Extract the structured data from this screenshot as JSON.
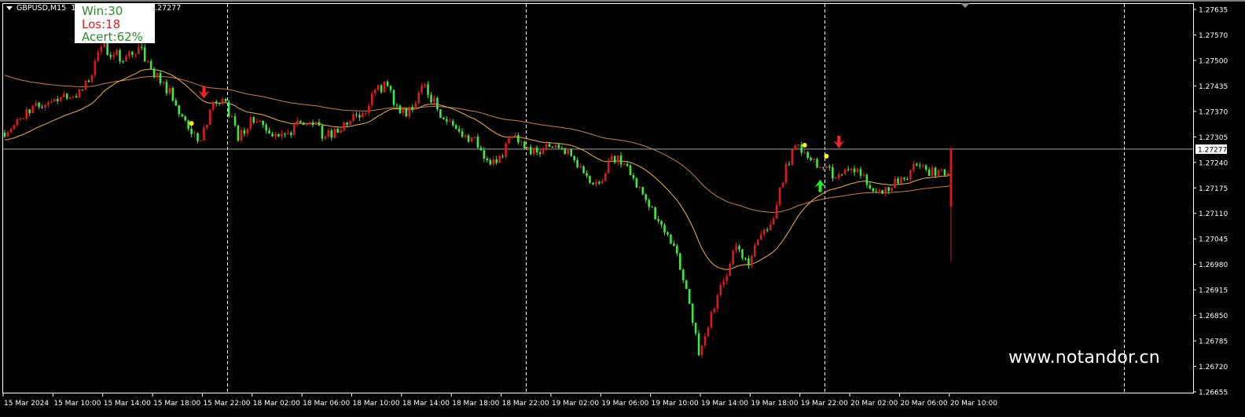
{
  "header": {
    "symbol_timeframe": "GBPUSD,M15",
    "ohlc_visible_head": "1.",
    "ohlc_visible_tail": ".27277"
  },
  "stats_box": {
    "win": "Win:30",
    "los": "Los:18",
    "acert": "Acert:62%"
  },
  "watermark": "www.notandor.cn",
  "colors": {
    "background": "#000000",
    "bull_candle": "#e01818",
    "bear_candle": "#3ee83e",
    "fast_ma": "#f0b050",
    "slow_ma": "#c8804a",
    "grid_separator": "#ffffff",
    "bid_line": "#a0a0a0",
    "signal_dot": "#ffff00",
    "buy_arrow": "#22ee22",
    "sell_arrow": "#ff2020"
  },
  "chart_data": {
    "type": "candlestick",
    "symbol": "GBPUSD",
    "timeframe": "M15",
    "current_price": "1.27277",
    "ylim": [
      1.26655,
      1.27635
    ],
    "y_ticks": [
      "1.27635",
      "1.27570",
      "1.27500",
      "1.27435",
      "1.27370",
      "1.27305",
      "1.27240",
      "1.27175",
      "1.27110",
      "1.27045",
      "1.26980",
      "1.26915",
      "1.26850",
      "1.26785",
      "1.26720",
      "1.26655"
    ],
    "x_ticks": [
      "15 Mar 2024",
      "15 Mar 10:00",
      "15 Mar 14:00",
      "15 Mar 18:00",
      "15 Mar 22:00",
      "18 Mar 02:00",
      "18 Mar 06:00",
      "18 Mar 10:00",
      "18 Mar 14:00",
      "18 Mar 18:00",
      "18 Mar 22:00",
      "19 Mar 02:00",
      "19 Mar 06:00",
      "19 Mar 10:00",
      "19 Mar 14:00",
      "19 Mar 18:00",
      "19 Mar 22:00",
      "20 Mar 02:00",
      "20 Mar 06:00",
      "20 Mar 10:00"
    ],
    "day_separators": [
      "18 Mar 00:00",
      "19 Mar 00:00",
      "20 Mar 00:00",
      "21 Mar 00:00"
    ],
    "hourly_close": [
      [
        "15 Mar 06:00",
        1.27339
      ],
      [
        "15 Mar 07:00",
        1.27379
      ],
      [
        "15 Mar 08:00",
        1.27385
      ],
      [
        "15 Mar 09:00",
        1.27399
      ],
      [
        "15 Mar 10:00",
        1.27419
      ],
      [
        "15 Mar 11:00",
        1.27409
      ],
      [
        "15 Mar 12:00",
        1.27449
      ],
      [
        "15 Mar 13:00",
        1.27539
      ],
      [
        "15 Mar 14:00",
        1.27519
      ],
      [
        "15 Mar 15:00",
        1.27515
      ],
      [
        "15 Mar 16:00",
        1.27539
      ],
      [
        "15 Mar 17:00",
        1.27483
      ],
      [
        "15 Mar 18:00",
        1.27449
      ],
      [
        "15 Mar 19:00",
        1.27389
      ],
      [
        "15 Mar 20:00",
        1.27329
      ],
      [
        "15 Mar 21:00",
        1.27299
      ],
      [
        "15 Mar 22:00",
        1.27399
      ],
      [
        "15 Mar 23:00",
        1.27399
      ],
      [
        "18 Mar 00:00",
        1.27299
      ],
      [
        "18 Mar 01:00",
        1.27359
      ],
      [
        "18 Mar 02:00",
        1.27339
      ],
      [
        "18 Mar 03:00",
        1.27315
      ],
      [
        "18 Mar 04:00",
        1.27319
      ],
      [
        "18 Mar 05:00",
        1.27345
      ],
      [
        "18 Mar 06:00",
        1.27339
      ],
      [
        "18 Mar 07:00",
        1.27309
      ],
      [
        "18 Mar 08:00",
        1.27319
      ],
      [
        "18 Mar 09:00",
        1.27349
      ],
      [
        "18 Mar 10:00",
        1.27369
      ],
      [
        "18 Mar 11:00",
        1.27429
      ],
      [
        "18 Mar 12:00",
        1.27439
      ],
      [
        "18 Mar 13:00",
        1.27369
      ],
      [
        "18 Mar 14:00",
        1.27379
      ],
      [
        "18 Mar 15:00",
        1.27443
      ],
      [
        "18 Mar 16:00",
        1.27379
      ],
      [
        "18 Mar 17:00",
        1.27349
      ],
      [
        "18 Mar 18:00",
        1.27309
      ],
      [
        "18 Mar 19:00",
        1.27309
      ],
      [
        "18 Mar 20:00",
        1.27249
      ],
      [
        "18 Mar 21:00",
        1.27259
      ],
      [
        "18 Mar 22:00",
        1.27309
      ],
      [
        "18 Mar 23:00",
        1.27279
      ],
      [
        "19 Mar 00:00",
        1.27269
      ],
      [
        "19 Mar 01:00",
        1.27283
      ],
      [
        "19 Mar 02:00",
        1.27279
      ],
      [
        "19 Mar 03:00",
        1.27249
      ],
      [
        "19 Mar 04:00",
        1.27209
      ],
      [
        "19 Mar 05:00",
        1.27189
      ],
      [
        "19 Mar 06:00",
        1.27259
      ],
      [
        "19 Mar 07:00",
        1.27239
      ],
      [
        "19 Mar 08:00",
        1.27179
      ],
      [
        "19 Mar 09:00",
        1.27129
      ],
      [
        "19 Mar 10:00",
        1.27083
      ],
      [
        "19 Mar 11:00",
        1.27029
      ],
      [
        "19 Mar 12:00",
        1.26919
      ],
      [
        "19 Mar 13:00",
        1.26749
      ],
      [
        "19 Mar 14:00",
        1.26859
      ],
      [
        "19 Mar 15:00",
        1.26939
      ],
      [
        "19 Mar 16:00",
        1.27029
      ],
      [
        "19 Mar 17:00",
        1.26979
      ],
      [
        "19 Mar 18:00",
        1.27059
      ],
      [
        "19 Mar 19:00",
        1.27099
      ],
      [
        "19 Mar 20:00",
        1.27239
      ],
      [
        "19 Mar 21:00",
        1.27289
      ],
      [
        "19 Mar 22:00",
        1.27249
      ],
      [
        "19 Mar 23:00",
        1.27229
      ],
      [
        "20 Mar 00:00",
        1.27203
      ],
      [
        "20 Mar 01:00",
        1.27223
      ],
      [
        "20 Mar 02:00",
        1.27209
      ],
      [
        "20 Mar 03:00",
        1.27169
      ],
      [
        "20 Mar 04:00",
        1.27179
      ],
      [
        "20 Mar 05:00",
        1.27189
      ],
      [
        "20 Mar 06:00",
        1.27223
      ],
      [
        "20 Mar 07:00",
        1.27235
      ],
      [
        "20 Mar 08:00",
        1.27209
      ],
      [
        "20 Mar 09:00",
        1.27215
      ],
      [
        "20 Mar 10:00",
        1.27277
      ]
    ],
    "signals": [
      {
        "type": "dot",
        "time": "15 Mar 21:00",
        "price": 1.27343
      },
      {
        "type": "sell-arrow",
        "time": "15 Mar 22:00",
        "price": 1.27415
      },
      {
        "type": "dot",
        "time": "19 Mar 22:15",
        "price": 1.27287
      },
      {
        "type": "buy-arrow",
        "time": "19 Mar 23:30",
        "price": 1.27191
      },
      {
        "type": "dot",
        "time": "20 Mar 00:00",
        "price": 1.27259
      },
      {
        "type": "sell-arrow",
        "time": "20 Mar 01:00",
        "price": 1.27287
      }
    ]
  }
}
